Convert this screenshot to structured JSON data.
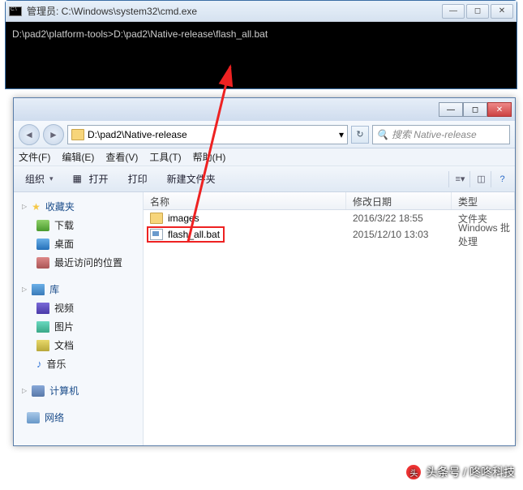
{
  "cmd": {
    "title": "管理员: C:\\Windows\\system32\\cmd.exe",
    "line": "D:\\pad2\\platform-tools>D:\\pad2\\Native-release\\flash_all.bat"
  },
  "explorer": {
    "address": "D:\\pad2\\Native-release",
    "address_dd": "▾",
    "search_placeholder": "搜索 Native-release",
    "menu": {
      "file": "文件(F)",
      "edit": "编辑(E)",
      "view": "查看(V)",
      "tools": "工具(T)",
      "help": "帮助(H)"
    },
    "toolbar": {
      "organize": "组织",
      "open": "打开",
      "print": "打印",
      "newfolder": "新建文件夹"
    },
    "cols": {
      "name": "名称",
      "date": "修改日期",
      "type": "类型"
    },
    "rows": [
      {
        "name": "images",
        "date": "2016/3/22 18:55",
        "type": "文件夹"
      },
      {
        "name": "flash_all.bat",
        "date": "2015/12/10 13:03",
        "type": "Windows 批处理"
      }
    ],
    "sidebar": {
      "fav": "收藏夹",
      "dl": "下载",
      "desktop": "桌面",
      "recent": "最近访问的位置",
      "lib": "库",
      "video": "视频",
      "pic": "图片",
      "doc": "文档",
      "music": "音乐",
      "computer": "计算机",
      "network": "网络"
    }
  },
  "watermark": "头条号 / 咚咚科技"
}
